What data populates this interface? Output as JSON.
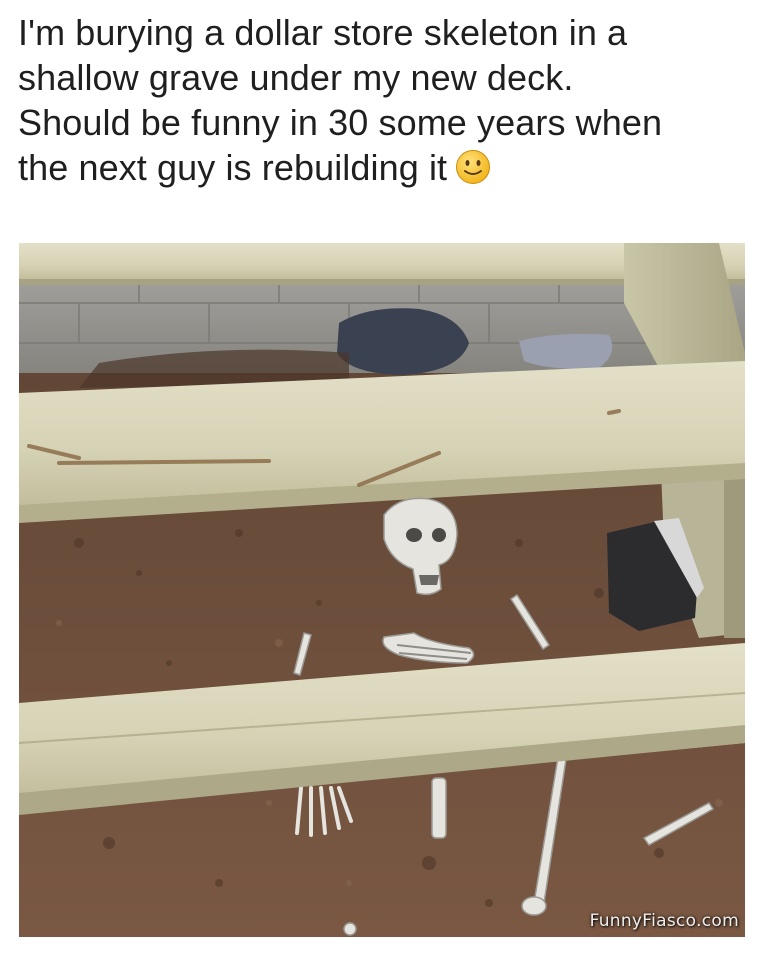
{
  "post": {
    "caption_lines": [
      "I'm burying a dollar store skeleton in a",
      "shallow grave under my new deck.",
      "Should be funny in 30 some years when",
      "the next guy is rebuilding it"
    ],
    "emoji": "slightly-smiling-face-icon"
  },
  "photo": {
    "watermark": "FunnyFiasco.com"
  },
  "colors": {
    "background": "#ffffff",
    "text": "#1f1f1f",
    "lumber": "#d8d4b8",
    "dirt": "#6b4d3b",
    "emoji_fill": "#f7c948"
  }
}
